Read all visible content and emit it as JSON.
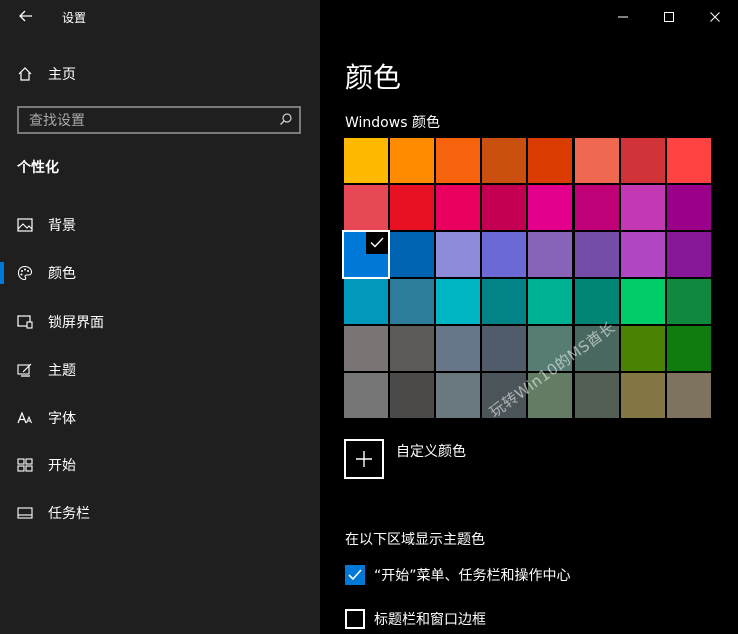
{
  "window": {
    "title": "设置",
    "controls": [
      "minimize-icon",
      "maximize-icon",
      "close-icon"
    ]
  },
  "sidebar": {
    "home_label": "主页",
    "search_placeholder": "查找设置",
    "section_title": "个性化",
    "active_item": "颜色",
    "items": [
      {
        "label": "背景",
        "icon": "picture-icon"
      },
      {
        "label": "颜色",
        "icon": "palette-icon"
      },
      {
        "label": "锁屏界面",
        "icon": "lock-screen-icon"
      },
      {
        "label": "主题",
        "icon": "theme-brush-icon"
      },
      {
        "label": "字体",
        "icon": "font-icon"
      },
      {
        "label": "开始",
        "icon": "start-tiles-icon"
      },
      {
        "label": "任务栏",
        "icon": "taskbar-icon"
      }
    ],
    "accent_color": "#0078d7"
  },
  "main": {
    "page_title": "颜色",
    "windows_colors_title": "Windows 颜色",
    "swatches": [
      [
        "#ffb900",
        "#ff8c00",
        "#f7630c",
        "#ca5010",
        "#da3b01",
        "#ef6950",
        "#d13438",
        "#ff4343"
      ],
      [
        "#e74856",
        "#e81123",
        "#ea005e",
        "#c30052",
        "#e3008c",
        "#bf0077",
        "#c239b3",
        "#9a0089"
      ],
      [
        "#0078d7",
        "#0063b1",
        "#8e8cd8",
        "#6b69d6",
        "#8764b8",
        "#744da9",
        "#b146c2",
        "#881798"
      ],
      [
        "#0099bc",
        "#2d7d9a",
        "#00b7c3",
        "#038387",
        "#00b294",
        "#018574",
        "#00cc6a",
        "#10893e"
      ],
      [
        "#7a7574",
        "#5d5a58",
        "#68768a",
        "#515c6b",
        "#567c73",
        "#486860",
        "#498205",
        "#107c10"
      ],
      [
        "#767676",
        "#4c4a48",
        "#69797e",
        "#4a5459",
        "#647c64",
        "#525e54",
        "#847545",
        "#7e735f"
      ]
    ],
    "selected_swatch": {
      "row": 2,
      "col": 0
    },
    "custom_color_label": "自定义颜色",
    "watermark": "玩转Win10的MS酋长",
    "show_accent_title": "在以下区域显示主题色",
    "checkboxes": [
      {
        "label": "“开始”菜单、任务栏和操作中心",
        "checked": true
      },
      {
        "label": "标题栏和窗口边框",
        "checked": false
      }
    ]
  }
}
